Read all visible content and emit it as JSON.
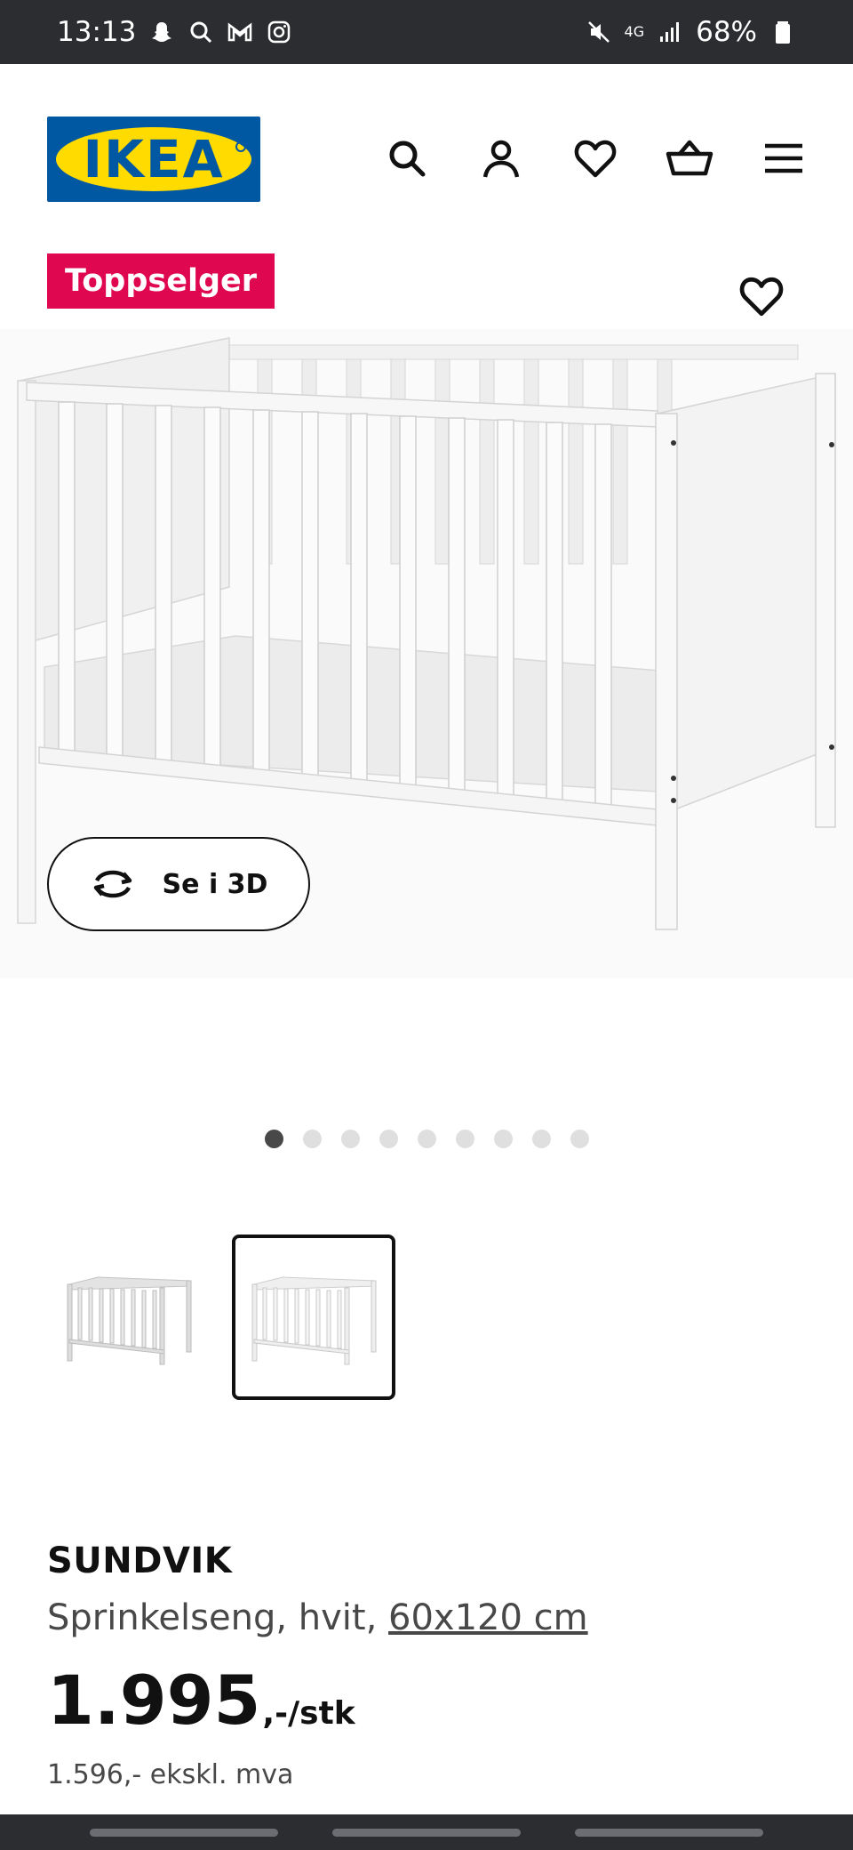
{
  "status": {
    "time": "13:13",
    "battery": "68%",
    "network": "4G"
  },
  "header": {
    "logo_text": "IKEA",
    "icons": [
      "search-icon",
      "account-icon",
      "heart-icon",
      "basket-icon",
      "menu-icon"
    ]
  },
  "badge": {
    "label": "Toppselger"
  },
  "view3d": {
    "label": "Se i 3D"
  },
  "carousel": {
    "count": 9,
    "active_index": 0
  },
  "product": {
    "name": "SUNDVIK",
    "desc_prefix": "Sprinkelseng, hvit, ",
    "desc_dims": "60x120 cm",
    "price_main": "1.995",
    "price_suffix": ",-/stk",
    "price_ex_vat": "1.596,- ekskl. mva"
  },
  "colors": {
    "ikea_blue": "#0058a3",
    "ikea_yellow": "#ffdb00",
    "badge_red": "#e00751"
  }
}
